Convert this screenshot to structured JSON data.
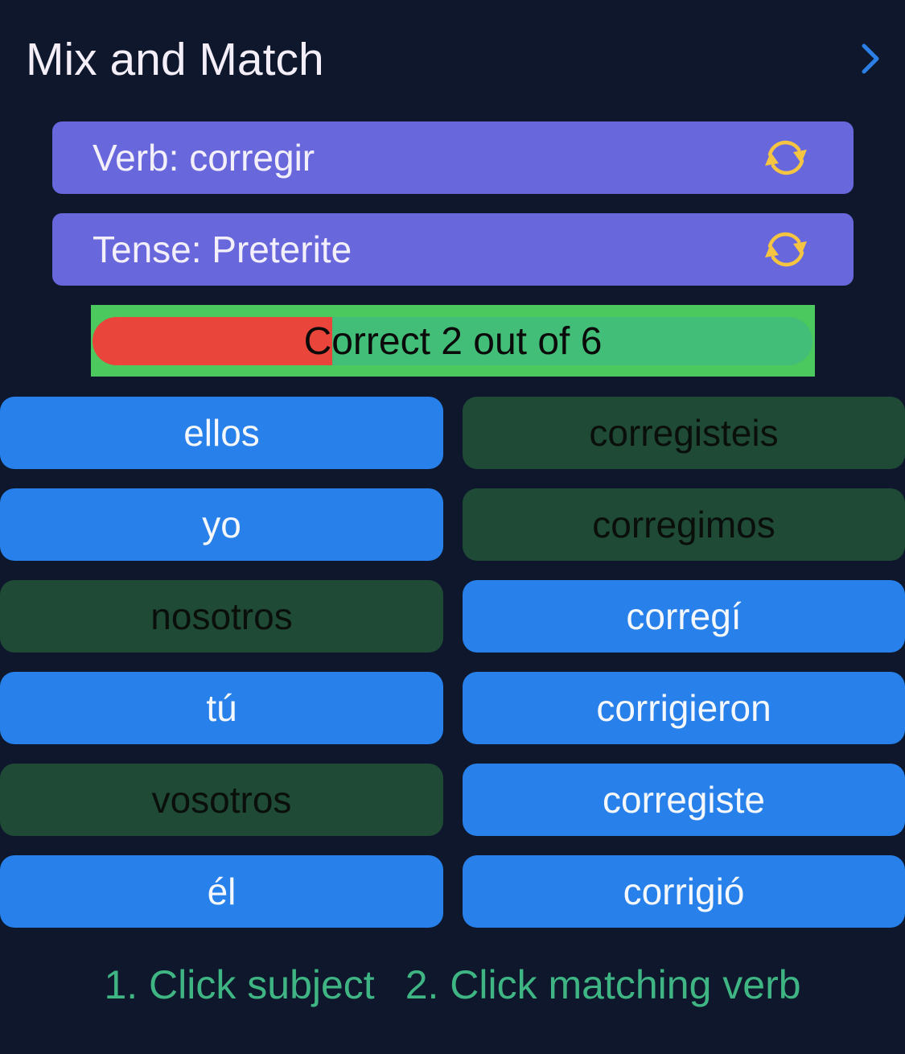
{
  "header": {
    "title": "Mix and Match",
    "next_icon": "chevron-right-icon"
  },
  "colors": {
    "background": "#0e172b",
    "selector": "#6868dc",
    "refresh_icon": "#f5c542",
    "chevron": "#2d7fe8",
    "progress_correct": "#ea453b",
    "progress_remaining": "#42be79",
    "tile_active": "#2880ea",
    "tile_matched": "#1e4a36",
    "instructions": "#3fb584"
  },
  "selectors": {
    "verb": {
      "label": "Verb: corregir",
      "icon": "refresh-icon"
    },
    "tense": {
      "label": "Tense: Preterite",
      "icon": "refresh-icon"
    }
  },
  "progress": {
    "text": "Correct 2 out of 6",
    "correct": 2,
    "total": 6
  },
  "subjects": [
    {
      "label": "ellos",
      "state": "active"
    },
    {
      "label": "yo",
      "state": "active"
    },
    {
      "label": "nosotros",
      "state": "matched"
    },
    {
      "label": "tú",
      "state": "active"
    },
    {
      "label": "vosotros",
      "state": "matched"
    },
    {
      "label": "él",
      "state": "active"
    }
  ],
  "verbs": [
    {
      "label": "corregisteis",
      "state": "matched"
    },
    {
      "label": "corregimos",
      "state": "matched"
    },
    {
      "label": "corregí",
      "state": "active"
    },
    {
      "label": "corrigieron",
      "state": "active"
    },
    {
      "label": "corregiste",
      "state": "active"
    },
    {
      "label": "corrigió",
      "state": "active"
    }
  ],
  "instructions": {
    "step1": "1. Click subject",
    "step2": "2. Click matching verb"
  }
}
